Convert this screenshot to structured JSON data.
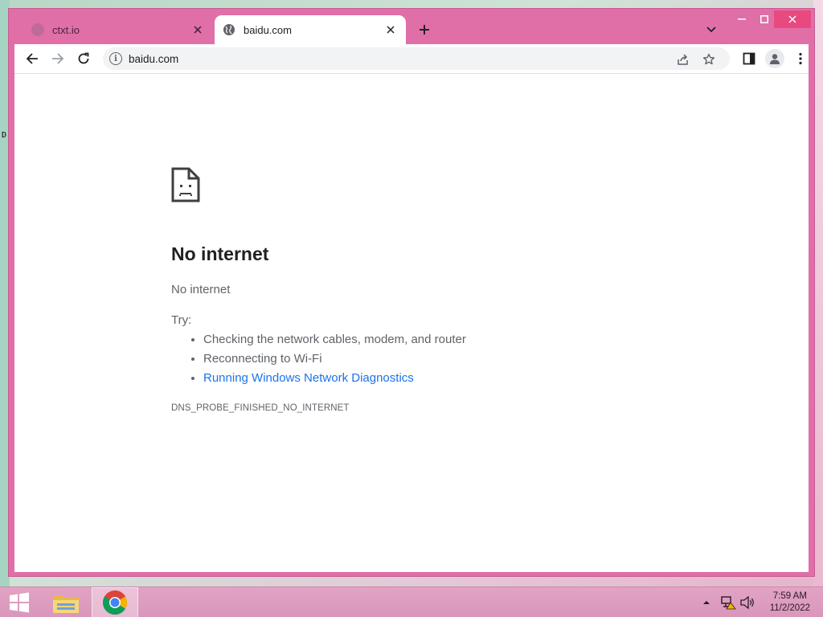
{
  "browser": {
    "tabs": [
      {
        "title": "ctxt.io",
        "active": false
      },
      {
        "title": "baidu.com",
        "active": true
      }
    ],
    "address_bar": {
      "url": "baidu.com"
    }
  },
  "error_page": {
    "title": "No internet",
    "subtitle": "No internet",
    "try_label": "Try:",
    "suggestions": [
      "Checking the network cables, modem, and router",
      "Reconnecting to Wi-Fi",
      "Running Windows Network Diagnostics"
    ],
    "error_code": "DNS_PROBE_FINISHED_NO_INTERNET"
  },
  "taskbar": {
    "time": "7:59 AM",
    "date": "11/2/2022"
  },
  "colors": {
    "window_frame": "#e06fa8",
    "link": "#1a73e8",
    "taskbar": "#d997bb"
  },
  "icons": {
    "tab_inactive": "ctxt-favicon-icon",
    "tab_active": "globe-icon",
    "error": "sad-page-icon"
  }
}
